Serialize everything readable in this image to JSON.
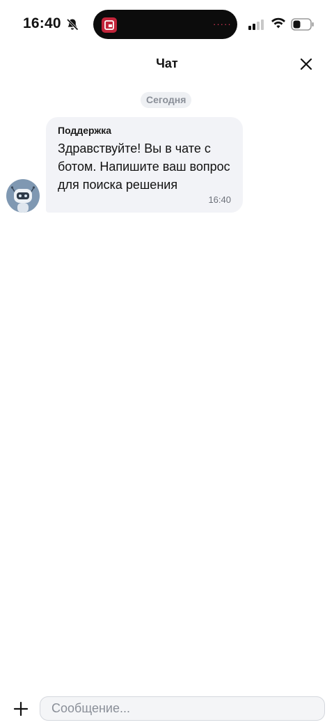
{
  "status_bar": {
    "time": "16:40",
    "island_indicator": "·····",
    "icons": [
      "bell-off-icon",
      "signal-icon",
      "wifi-icon",
      "battery-icon"
    ]
  },
  "header": {
    "title": "Чат",
    "close_icon": "close-icon"
  },
  "date_separator": "Сегодня",
  "messages": [
    {
      "sender": "Поддержка",
      "text": "Здравствуйте! Вы в чате с ботом. Напишите ваш вопрос для поиска решения",
      "time": "16:40",
      "avatar_icon": "robot-icon"
    }
  ],
  "composer": {
    "placeholder": "Сообщение...",
    "value": "",
    "add_icon": "plus-icon"
  },
  "colors": {
    "background": "#ffffff",
    "bubble": "#f2f3f7",
    "date_chip": "#eef0f3",
    "muted_text": "#8a8f98",
    "avatar_bg": "#7f98b2",
    "app_badge": "#c2243a"
  }
}
